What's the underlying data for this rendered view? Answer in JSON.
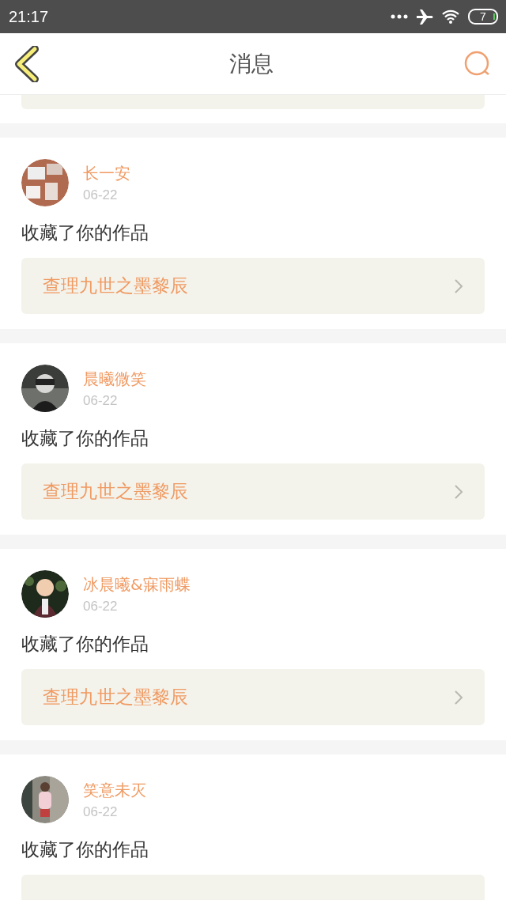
{
  "status_bar": {
    "time": "21:17",
    "battery": "7"
  },
  "header": {
    "title": "消息"
  },
  "messages": [
    {
      "user": "长一安",
      "date": "06-22",
      "action": "收藏了你的作品",
      "work": "查理九世之墨黎辰"
    },
    {
      "user": "晨曦微笑",
      "date": "06-22",
      "action": "收藏了你的作品",
      "work": "查理九世之墨黎辰"
    },
    {
      "user": "冰晨曦&寐雨蝶",
      "date": "06-22",
      "action": "收藏了你的作品",
      "work": "查理九世之墨黎辰"
    },
    {
      "user": "笑意未灭",
      "date": "06-22",
      "action": "收藏了你的作品"
    }
  ]
}
